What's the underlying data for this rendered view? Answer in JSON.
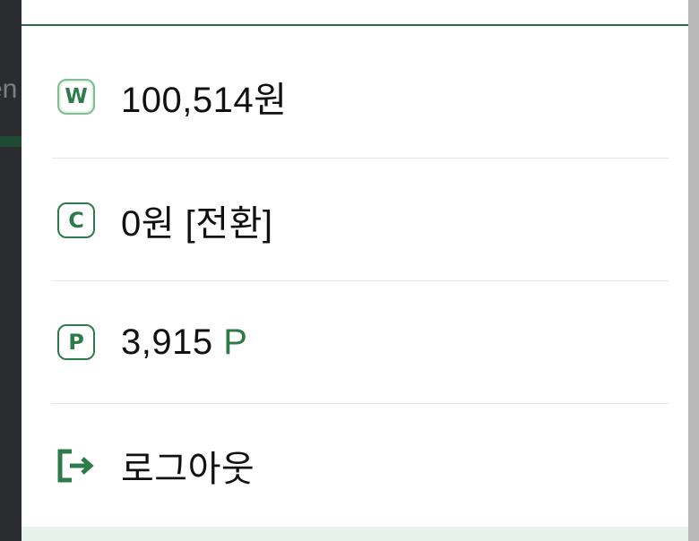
{
  "background": {
    "partial_text": "en"
  },
  "wallet": {
    "w": {
      "icon": "W",
      "label": "100,514원"
    },
    "c": {
      "icon": "C",
      "label": "0원 [전환]"
    },
    "p": {
      "icon": "P",
      "amount": "3,915",
      "unit": "P"
    },
    "logout": {
      "label": "로그아웃"
    }
  },
  "colors": {
    "accent": "#2d7a4a",
    "text": "#111111",
    "divider": "#e5e5e5"
  }
}
